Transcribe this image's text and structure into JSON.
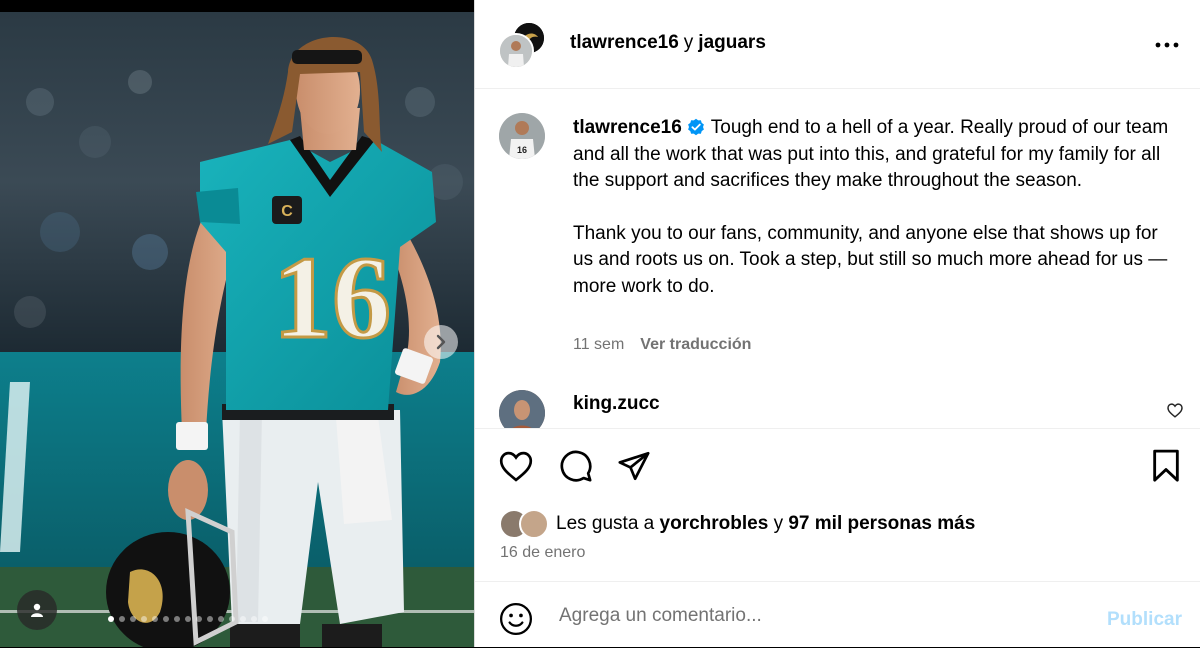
{
  "header": {
    "user_primary": "tlawrence16",
    "conjunction": "y",
    "user_collab": "jaguars"
  },
  "caption": {
    "username": "tlawrence16",
    "paragraph_1": "Tough end to a hell of a year. Really proud of our team and all the work that was put into this, and grateful for my family for all the support and sacrifices they make throughout the season.",
    "paragraph_2": "Thank you to our fans, community, and anyone else that shows up for us and roots us on. Took a step, but still so much more ahead for us — more work to do.",
    "time_ago": "11 sem",
    "translate_label": "Ver traducción"
  },
  "comment": {
    "username": "king.zucc"
  },
  "likes": {
    "prefix": "Les gusta a",
    "liker": "yorchrobles",
    "joiner": "y",
    "others": "97 mil personas más"
  },
  "post_date": "16 de enero",
  "composer": {
    "placeholder": "Agrega un comentario...",
    "publish_label": "Publicar"
  },
  "photo": {
    "jersey_number": "16",
    "captain_patch": "C"
  },
  "carousel": {
    "total_slides": 15,
    "active_index": 0
  },
  "icons": {
    "verified": "verified-badge-icon",
    "more": "more-options-icon",
    "like": "heart-icon",
    "comment": "comment-icon",
    "share": "paper-plane-icon",
    "save": "bookmark-icon",
    "emoji": "emoji-icon",
    "next": "chevron-right-icon",
    "tags": "user-tag-icon"
  },
  "colors": {
    "jersey_teal": "#0b9aa4",
    "verified_blue": "#0095f6",
    "publish_disabled": "#b2dffc",
    "meta_gray": "#737373"
  }
}
